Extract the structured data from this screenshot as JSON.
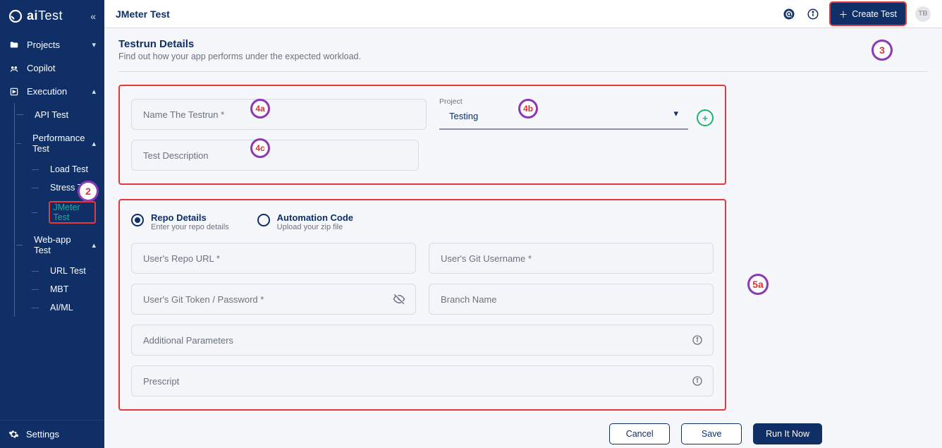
{
  "brand": {
    "part1": "ai",
    "part2": "Test"
  },
  "sidebar": {
    "collapse_icon": "«",
    "items": [
      {
        "icon": "folder",
        "label": "Projects",
        "exp": "v"
      },
      {
        "icon": "copilot",
        "label": "Copilot",
        "exp": ""
      },
      {
        "icon": "exec",
        "label": "Execution",
        "exp": "^"
      }
    ],
    "exec_children": [
      {
        "label": "API Test"
      },
      {
        "label": "Performance Test",
        "exp": "^",
        "children": [
          {
            "label": "Load Test"
          },
          {
            "label": "Stress Test"
          },
          {
            "label": "JMeter Test",
            "active": true
          }
        ]
      },
      {
        "label": "Web-app Test",
        "exp": "^",
        "children": [
          {
            "label": "URL Test"
          },
          {
            "label": "MBT"
          },
          {
            "label": "AI/ML"
          }
        ]
      }
    ],
    "settings_label": "Settings"
  },
  "header": {
    "title": "JMeter Test",
    "create_label": "Create Test",
    "avatar": "TB"
  },
  "details": {
    "title": "Testrun Details",
    "subtitle": "Find out how your app performs under the expected workload.",
    "name_placeholder": "Name The Testrun *",
    "desc_placeholder": "Test Description",
    "project_label": "Project",
    "project_value": "Testing"
  },
  "source": {
    "repo": {
      "title": "Repo Details",
      "sub": "Enter your repo details"
    },
    "code": {
      "title": "Automation Code",
      "sub": "Upload your zip file"
    },
    "fields": {
      "repo_url": "User's Repo URL *",
      "git_user": "User's Git Username *",
      "git_token": "User's Git Token / Password *",
      "branch": "Branch Name",
      "params": "Additional Parameters",
      "prescript": "Prescript"
    }
  },
  "buttons": {
    "cancel": "Cancel",
    "save": "Save",
    "run": "Run It Now"
  },
  "annotations": {
    "2": "2",
    "3": "3",
    "4a": "4a",
    "4b": "4b",
    "4c": "4c",
    "5a": "5a"
  }
}
